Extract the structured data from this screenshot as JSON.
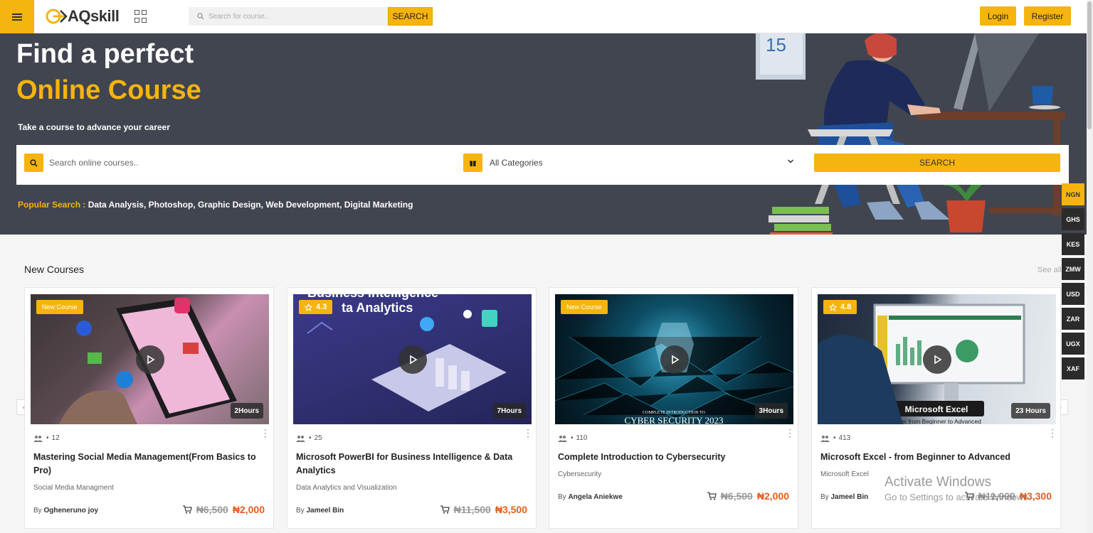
{
  "header": {
    "logo_text": "AQskill",
    "search_placeholder": "Search for course..",
    "search_label": "SEARCH",
    "login_label": "Login",
    "register_label": "Register"
  },
  "hero": {
    "title_line1": "Find a perfect",
    "title_line2": "Online Course",
    "subtitle": "Take a course to advance your career",
    "search_placeholder": "Search online courses..",
    "category_selected": "All Categories",
    "search_label": "SEARCH",
    "popular_label": "Popular Search :",
    "popular_items": "Data Analysis, Photoshop, Graphic Design, Web Development, Digital Marketing",
    "calendar_number": "15"
  },
  "currencies": [
    "NGN",
    "GHS",
    "KES",
    "ZMW",
    "USD",
    "ZAR",
    "UGX",
    "XAF"
  ],
  "active_currency": "NGN",
  "section": {
    "title": "New Courses",
    "see_all": "See all"
  },
  "courses": [
    {
      "badge": "New Course",
      "duration": "2Hours",
      "students": "12",
      "title": "Mastering Social Media Management(From Basics to Pro)",
      "category": "Social Media Managment",
      "author_prefix": "By",
      "author": "Ogheneruno joy",
      "old_price": "₦6,500",
      "new_price": "₦2,000"
    },
    {
      "badge": "4.3",
      "duration": "7Hours",
      "students": "25",
      "title": "Microsoft PowerBI for Business Intelligence & Data Analytics",
      "category": "Data Analytics and Visualization",
      "author_prefix": "By",
      "author": "Jameel Bin",
      "old_price": "₦11,500",
      "new_price": "₦3,500",
      "thumb_text1": "Business Intelligence",
      "thumb_text2": "ta Analytics"
    },
    {
      "badge": "New Course",
      "duration": "3Hours",
      "students": "110",
      "title": "Complete Introduction to Cybersecurity",
      "category": "Cybersecurity",
      "author_prefix": "By",
      "author": "Angela Aniekwe",
      "old_price": "₦6,500",
      "new_price": "₦2,000",
      "thumb_text1": "COMPLETE INTRODUCTION TO",
      "thumb_text2": "CYBER SECURITY 2023"
    },
    {
      "badge": "4.8",
      "duration": "23 Hours",
      "students": "413",
      "title": "Microsoft Excel - from Beginner to Advanced",
      "category": "Microsoft Excel",
      "author_prefix": "By",
      "author": "Jameel Bin",
      "old_price": "₦11,000",
      "new_price": "₦3,300",
      "thumb_text1": "Microsoft Excel",
      "thumb_text2": "Excel from Beginner to Advanced"
    }
  ],
  "watermark": {
    "line1": "Activate Windows",
    "line2": "Go to Settings to activate Windows."
  },
  "colors": {
    "accent": "#f6b40e",
    "hero_bg": "#41454f",
    "price_new": "#e55c1a"
  }
}
